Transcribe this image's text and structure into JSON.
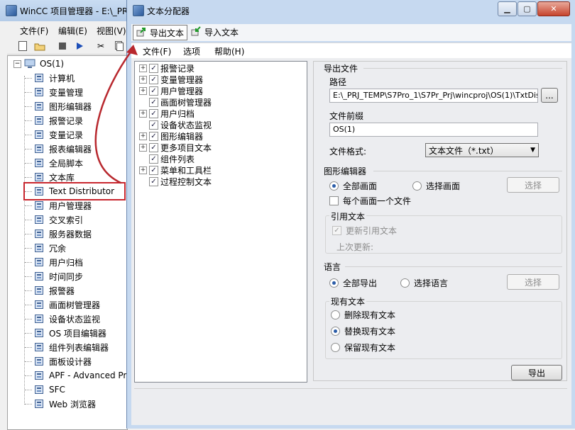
{
  "main_window": {
    "title": "WinCC 项目管理器 - E:\\_PR",
    "menu": [
      "文件(F)",
      "编辑(E)",
      "视图(V)"
    ],
    "tree": {
      "root": "OS(1)",
      "items": [
        {
          "label": "计算机",
          "icon": "computer-icon"
        },
        {
          "label": "变量管理",
          "icon": "tag-management-icon"
        },
        {
          "label": "图形编辑器",
          "icon": "graphics-designer-icon"
        },
        {
          "label": "报警记录",
          "icon": "alarm-logging-icon"
        },
        {
          "label": "变量记录",
          "icon": "tag-logging-icon"
        },
        {
          "label": "报表编辑器",
          "icon": "report-designer-icon"
        },
        {
          "label": "全局脚本",
          "icon": "global-script-icon"
        },
        {
          "label": "文本库",
          "icon": "text-library-icon"
        },
        {
          "label": "Text Distributor",
          "icon": "text-distributor-icon"
        },
        {
          "label": "用户管理器",
          "icon": "user-administrator-icon"
        },
        {
          "label": "交叉索引",
          "icon": "cross-reference-icon"
        },
        {
          "label": "服务器数据",
          "icon": "server-data-icon"
        },
        {
          "label": "冗余",
          "icon": "redundancy-icon"
        },
        {
          "label": "用户归档",
          "icon": "user-archive-icon"
        },
        {
          "label": "时间同步",
          "icon": "time-sync-icon"
        },
        {
          "label": "报警器",
          "icon": "horn-icon"
        },
        {
          "label": "画面树管理器",
          "icon": "picture-tree-icon"
        },
        {
          "label": "设备状态监视",
          "icon": "lifebeat-monitoring-icon"
        },
        {
          "label": "OS 项目编辑器",
          "icon": "os-project-editor-icon"
        },
        {
          "label": "组件列表编辑器",
          "icon": "component-list-icon"
        },
        {
          "label": "面板设计器",
          "icon": "faceplate-designer-icon"
        },
        {
          "label": "APF - Advanced Pr",
          "icon": "apf-icon"
        },
        {
          "label": "SFC",
          "icon": "sfc-icon"
        },
        {
          "label": "Web 浏览器",
          "icon": "web-navigator-icon"
        }
      ]
    }
  },
  "dialog": {
    "title": "文本分配器",
    "toolbar": {
      "export": "导出文本",
      "import": "导入文本"
    },
    "menu": [
      "文件(F)",
      "选项",
      "帮助(H)"
    ],
    "text_tree": [
      {
        "label": "报警记录",
        "expandable": true,
        "checked": true
      },
      {
        "label": "变量管理器",
        "expandable": true,
        "checked": true
      },
      {
        "label": "用户管理器",
        "expandable": true,
        "checked": true
      },
      {
        "label": "画面树管理器",
        "expandable": false,
        "checked": true
      },
      {
        "label": "用户归档",
        "expandable": true,
        "checked": true
      },
      {
        "label": "设备状态监视",
        "expandable": false,
        "checked": true
      },
      {
        "label": "图形编辑器",
        "expandable": true,
        "checked": true
      },
      {
        "label": "更多项目文本",
        "expandable": true,
        "checked": true
      },
      {
        "label": "组件列表",
        "expandable": false,
        "checked": true
      },
      {
        "label": "菜单和工具栏",
        "expandable": true,
        "checked": true
      },
      {
        "label": "过程控制文本",
        "expandable": false,
        "checked": true
      }
    ],
    "export_file": {
      "section": "导出文件",
      "path_label": "路径",
      "path_value": "E:\\_PRJ_TEMP\\S7Pro_1\\S7Pr_Prj\\wincproj\\OS(1)\\TxtDist\\",
      "browse": "...",
      "prefix_label": "文件前缀",
      "prefix_value": "OS(1)",
      "format_label": "文件格式:",
      "format_value": "文本文件（*.txt）"
    },
    "graphics": {
      "section": "图形编辑器",
      "all_pictures": "全部画面",
      "select_pictures": "选择画面",
      "select_button": "选择",
      "one_file_per_picture": "每个画面一个文件",
      "ref_text_section": "引用文本",
      "update_ref_text": "更新引用文本",
      "last_update": "上次更新:"
    },
    "language": {
      "section": "语言",
      "export_all": "全部导出",
      "select_language": "选择语言",
      "select_button": "选择",
      "existing_text_section": "现有文本",
      "delete_existing": "删除现有文本",
      "replace_existing": "替换现有文本",
      "keep_existing": "保留现有文本"
    },
    "export_button": "导出"
  },
  "colors": {
    "highlight": "#c8262e",
    "arrow": "#b8282e",
    "title_bar": "#c6d9f0"
  }
}
